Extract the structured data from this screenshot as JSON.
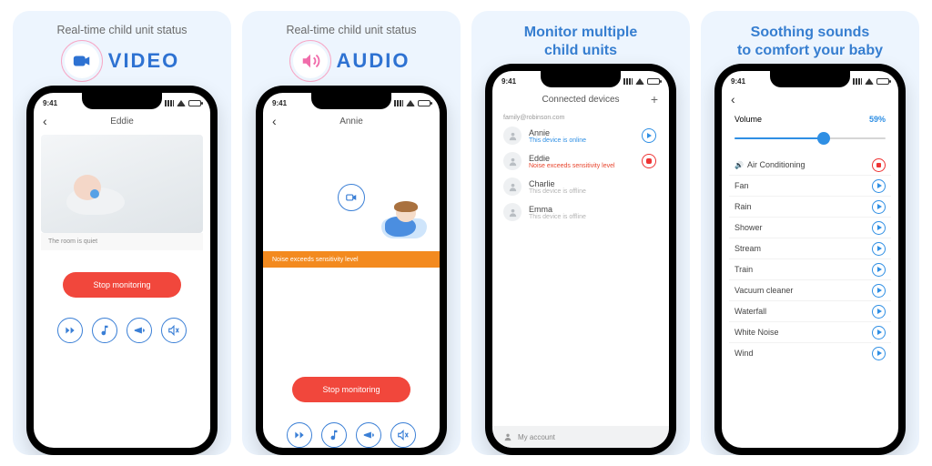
{
  "statusbar": {
    "time": "9:41"
  },
  "panel1": {
    "header_small": "Real-time child unit status",
    "badge_label": "VIDEO",
    "nav_title": "Eddie",
    "caption": "The room is quiet",
    "stop_label": "Stop monitoring"
  },
  "panel2": {
    "header_small": "Real-time child unit status",
    "badge_label": "AUDIO",
    "nav_title": "Annie",
    "alert": "Noise exceeds sensitivity level",
    "stop_label": "Stop monitoring"
  },
  "panel3": {
    "header_line1": "Monitor multiple",
    "header_line2": "child units",
    "nav_title": "Connected devices",
    "email": "family@robinson.com",
    "account_label": "My account",
    "devices": [
      {
        "name": "Annie",
        "sub": "This device is online",
        "sub_class": "sub-online",
        "action": "play"
      },
      {
        "name": "Eddie",
        "sub": "Noise exceeds sensitivity level",
        "sub_class": "sub-alert",
        "action": "rec"
      },
      {
        "name": "Charlie",
        "sub": "This device is offline",
        "sub_class": "sub-off",
        "action": ""
      },
      {
        "name": "Emma",
        "sub": "This device is offline",
        "sub_class": "sub-off",
        "action": ""
      }
    ]
  },
  "panel4": {
    "header_line1": "Soothing sounds",
    "header_line2": "to comfort your baby",
    "volume_label": "Volume",
    "volume_value": "59%",
    "volume_pct": 59,
    "sounds": [
      {
        "name": "Air Conditioning",
        "playing": true
      },
      {
        "name": "Fan"
      },
      {
        "name": "Rain"
      },
      {
        "name": "Shower"
      },
      {
        "name": "Stream"
      },
      {
        "name": "Train"
      },
      {
        "name": "Vacuum cleaner"
      },
      {
        "name": "Waterfall"
      },
      {
        "name": "White Noise"
      },
      {
        "name": "Wind"
      }
    ]
  },
  "colors": {
    "blue": "#2f8fe4",
    "pink": "#f06caa",
    "alert_red": "#e8452d",
    "orange": "#f38a1f"
  }
}
